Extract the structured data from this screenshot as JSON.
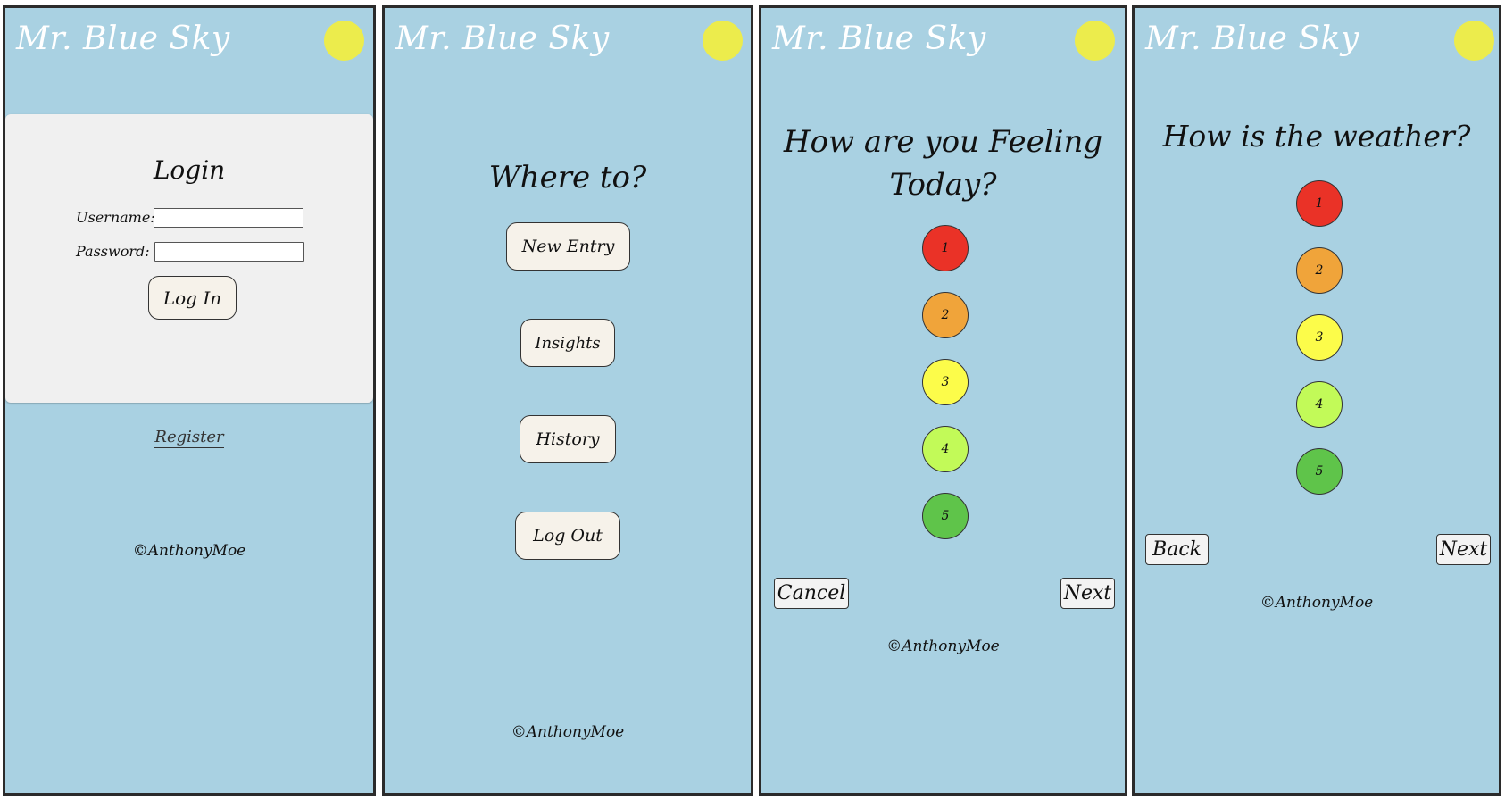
{
  "app_title": "Mr. Blue Sky",
  "colors": {
    "background": "#a9d1e2",
    "sun": "#ecec4c",
    "rating_1": "#ea3227",
    "rating_2": "#f0a43a",
    "rating_3": "#fcfc4a",
    "rating_4": "#c2fa58",
    "rating_5": "#5fc44a"
  },
  "copyright": "©AnthonyMoe",
  "login_screen": {
    "heading": "Login",
    "username_label": "Username:",
    "username_value": "",
    "password_label": "Password:",
    "password_value": "",
    "login_button": "Log In",
    "register_link": "Register"
  },
  "menu_screen": {
    "heading": "Where to?",
    "buttons": [
      "New Entry",
      "Insights",
      "History",
      "Log Out"
    ]
  },
  "feeling_screen": {
    "heading_line1": "How are you Feeling",
    "heading_line2": "Today?",
    "ratings": [
      "1",
      "2",
      "3",
      "4",
      "5"
    ],
    "cancel_button": "Cancel",
    "next_button": "Next"
  },
  "weather_screen": {
    "heading": "How is the weather?",
    "ratings": [
      "1",
      "2",
      "3",
      "4",
      "5"
    ],
    "back_button": "Back",
    "next_button": "Next"
  }
}
